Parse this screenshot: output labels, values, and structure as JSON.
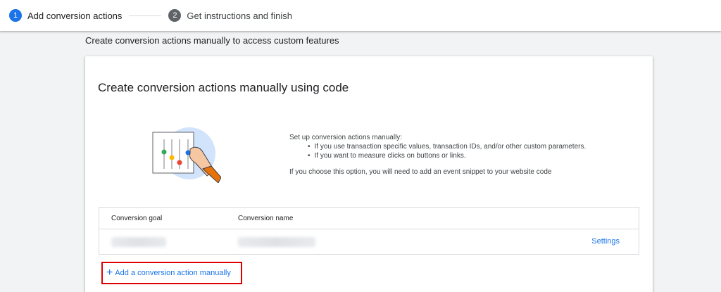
{
  "stepper": {
    "steps": [
      {
        "number": "1",
        "label": "Add conversion actions"
      },
      {
        "number": "2",
        "label": "Get instructions and finish"
      }
    ]
  },
  "page": {
    "heading": "Create conversion actions manually to access custom features"
  },
  "card": {
    "title": "Create conversion actions manually using code",
    "intro": "Set up conversion actions manually:",
    "bullets": [
      "If you use transaction specific values, transaction IDs, and/or other custom parameters.",
      "If you want to measure clicks on buttons or links."
    ],
    "note": "If you choose this option, you will need to add an event snippet to your website code"
  },
  "table": {
    "columns": [
      "Conversion goal",
      "Conversion name"
    ],
    "row": {
      "settings_label": "Settings"
    }
  },
  "add_action": {
    "icon": "plus-icon",
    "label": "Add a conversion action manually"
  },
  "colors": {
    "accent": "#1a73e8",
    "highlight_border": "#e00000",
    "background": "#f1f3f4"
  }
}
